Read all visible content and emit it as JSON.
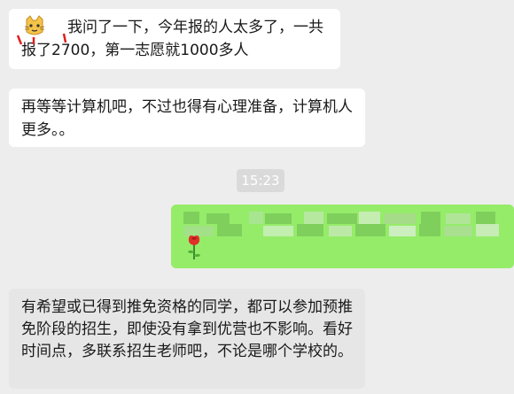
{
  "messages": [
    {
      "id": "m1",
      "direction": "incoming",
      "text": "我问了一下，今年报的人太多了，一共报了2700，第一志愿就1000多人",
      "emoji": "cat-face-emoji"
    },
    {
      "id": "m2",
      "direction": "incoming",
      "text": "再等等计算机吧，不过也得有心理准备，计算机人更多。。"
    },
    {
      "id": "m3",
      "direction": "outgoing",
      "text": "",
      "redacted": true,
      "emoji": "rose-emoji"
    },
    {
      "id": "m4",
      "direction": "incoming",
      "text": "有希望或已得到推免资格的同学，都可以参加预推免阶段的招生，即使没有拿到优营也不影响。看好时间点，多联系招生老师吧，不论是哪个学校的。"
    }
  ],
  "timestamp": "15:23",
  "colors": {
    "background": "#ededed",
    "incoming_bubble": "#ffffff",
    "outgoing_bubble": "#95ec69",
    "timestamp_bg": "#dadada"
  }
}
